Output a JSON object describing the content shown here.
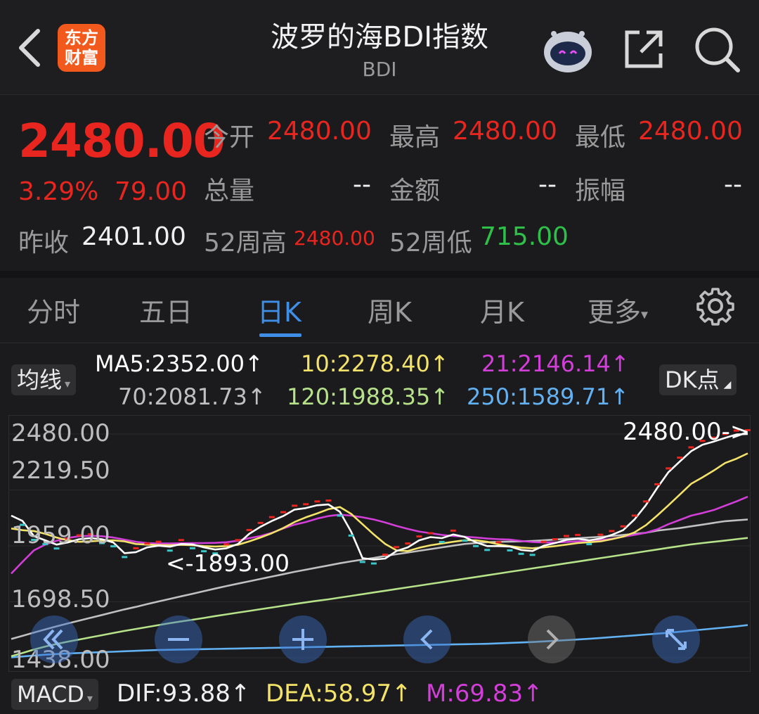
{
  "header": {
    "title": "波罗的海BDI指数",
    "subtitle": "BDI",
    "logo_text": [
      "东方",
      "财富"
    ],
    "icons": [
      "back-arrow-icon",
      "robot-assistant-icon",
      "share-icon",
      "search-icon"
    ]
  },
  "quote": {
    "price": "2480.00",
    "change_pct": "3.29%",
    "change": "79.00",
    "prev_close_label": "昨收",
    "prev_close": "2401.00",
    "fields": {
      "open_label": "今开",
      "open": "2480.00",
      "high_label": "最高",
      "high": "2480.00",
      "low_label": "最低",
      "low": "2480.00",
      "volume_label": "总量",
      "volume": "--",
      "amount_label": "金额",
      "amount": "--",
      "amplitude_label": "振幅",
      "amplitude": "--",
      "w52_high_label": "52周高",
      "w52_high": "2480.00",
      "w52_low_label": "52周低",
      "w52_low": "715.00"
    }
  },
  "tabs": [
    {
      "label": "分时",
      "active": false
    },
    {
      "label": "五日",
      "active": false
    },
    {
      "label": "日K",
      "active": true
    },
    {
      "label": "周K",
      "active": false
    },
    {
      "label": "月K",
      "active": false
    },
    {
      "label": "更多",
      "active": false
    }
  ],
  "indicators": {
    "ma_selector": "均线",
    "dk_button": "DK点",
    "ma5": "MA5:2352.00↑",
    "ma10": "10:2278.40↑",
    "ma21": "21:2146.14↑",
    "ma70": "70:2081.73↑",
    "ma120": "120:1988.35↑",
    "ma250": "250:1589.71↑"
  },
  "colors": {
    "up": "#e8261f",
    "down": "#2fc04a",
    "accent": "#3f8fe8",
    "ma5": "#ffffff",
    "ma10": "#f3e36a",
    "ma21": "#d23ed8",
    "ma70": "#c0c0c0",
    "ma120": "#b6e28a",
    "ma250": "#62b1f2"
  },
  "chart_data": {
    "type": "line",
    "y_ticks": [
      "2480.00",
      "2219.50",
      "1959.00",
      "1698.50",
      "1438.00"
    ],
    "ylim": [
      1438,
      2480
    ],
    "max_label": "2480.00->",
    "min_label": "<-1893.00",
    "x": [
      0,
      1,
      2,
      3,
      4,
      5,
      6,
      7,
      8,
      9,
      10,
      11,
      12,
      13,
      14,
      15,
      16,
      17,
      18,
      19,
      20,
      21,
      22,
      23,
      24,
      25,
      26,
      27,
      28,
      29,
      30,
      31,
      32,
      33,
      34,
      35,
      36,
      37,
      38,
      39,
      40,
      41,
      42,
      43,
      44,
      45,
      46,
      47,
      48,
      49,
      50,
      51,
      52,
      53,
      54,
      55,
      56,
      57,
      58,
      59,
      60,
      61,
      62,
      63,
      64,
      65
    ],
    "series": [
      {
        "name": "MA5",
        "values": [
          2100,
          2075,
          2005,
          1985,
          1965,
          1975,
          1990,
          1995,
          1990,
          1975,
          1925,
          1930,
          1952,
          1960,
          1955,
          1968,
          1966,
          1952,
          1942,
          1948,
          1968,
          2015,
          2048,
          2075,
          2098,
          2128,
          2135,
          2148,
          2152,
          2118,
          2025,
          1902,
          1895,
          1900,
          1935,
          1952,
          1985,
          2000,
          1995,
          2012,
          2001,
          1976,
          1958,
          1958,
          1956,
          1940,
          1935,
          1960,
          1972,
          1987,
          1992,
          1985,
          1993,
          2010,
          2032,
          2082,
          2148,
          2228,
          2302,
          2352,
          2400,
          2430,
          2445,
          2462,
          2478,
          2480
        ]
      },
      {
        "name": "10",
        "values": [
          2040,
          2032,
          2028,
          2015,
          1998,
          1985,
          1978,
          1980,
          1984,
          1985,
          1980,
          1968,
          1965,
          1963,
          1962,
          1964,
          1962,
          1958,
          1956,
          1958,
          1964,
          1980,
          1998,
          2018,
          2042,
          2070,
          2092,
          2110,
          2130,
          2140,
          2108,
          2060,
          2012,
          1968,
          1938,
          1935,
          1950,
          1962,
          1970,
          1978,
          1985,
          1985,
          1978,
          1966,
          1958,
          1951,
          1948,
          1952,
          1958,
          1965,
          1972,
          1976,
          1980,
          1990,
          2002,
          2022,
          2055,
          2100,
          2148,
          2198,
          2248,
          2278,
          2310,
          2345,
          2365,
          2390
        ]
      },
      {
        "name": "21",
        "values": [
          1830,
          1885,
          1938,
          1965,
          1983,
          1996,
          2004,
          2006,
          2004,
          1998,
          1988,
          1978,
          1972,
          1970,
          1970,
          1971,
          1972,
          1972,
          1973,
          1976,
          1983,
          1995,
          2005,
          2020,
          2040,
          2058,
          2070,
          2086,
          2098,
          2104,
          2100,
          2092,
          2082,
          2068,
          2052,
          2038,
          2026,
          2018,
          2010,
          2005,
          2002,
          1998,
          1993,
          1990,
          1988,
          1982,
          1977,
          1975,
          1975,
          1977,
          1980,
          1982,
          1986,
          1992,
          2002,
          2010,
          2020,
          2036,
          2060,
          2080,
          2100,
          2112,
          2126,
          2146,
          2166,
          2188
        ]
      },
      {
        "name": "70",
        "values": [
          1525,
          1540,
          1555,
          1570,
          1584,
          1598,
          1611,
          1624,
          1637,
          1650,
          1663,
          1675,
          1688,
          1700,
          1712,
          1724,
          1736,
          1748,
          1760,
          1772,
          1783,
          1794,
          1805,
          1816,
          1827,
          1838,
          1848,
          1858,
          1868,
          1878,
          1887,
          1895,
          1903,
          1912,
          1920,
          1928,
          1936,
          1944,
          1952,
          1960,
          1968,
          1972,
          1976,
          1978,
          1979,
          1980,
          1982,
          1985,
          1988,
          1992,
          1995,
          1998,
          2001,
          2005,
          2010,
          2015,
          2020,
          2030,
          2036,
          2042,
          2050,
          2058,
          2066,
          2074,
          2078,
          2082
        ]
      },
      {
        "name": "120",
        "values": [
          1445,
          1460,
          1476,
          1490,
          1502,
          1513,
          1523,
          1533,
          1543,
          1553,
          1563,
          1572,
          1581,
          1590,
          1599,
          1607,
          1615,
          1623,
          1632,
          1640,
          1648,
          1656,
          1664,
          1672,
          1680,
          1688,
          1696,
          1703,
          1710,
          1718,
          1726,
          1734,
          1742,
          1750,
          1758,
          1766,
          1774,
          1782,
          1790,
          1798,
          1806,
          1814,
          1822,
          1830,
          1838,
          1846,
          1854,
          1862,
          1870,
          1878,
          1886,
          1894,
          1902,
          1910,
          1918,
          1926,
          1934,
          1942,
          1950,
          1958,
          1966,
          1972,
          1978,
          1984,
          1990,
          1996
        ]
      },
      {
        "name": "250",
        "values": [
          1440,
          1444,
          1448,
          1452,
          1455,
          1458,
          1460,
          1462,
          1464,
          1466,
          1468,
          1470,
          1472,
          1474,
          1475,
          1476,
          1477,
          1478,
          1479,
          1480,
          1481,
          1482,
          1483,
          1484,
          1485,
          1486,
          1487,
          1488,
          1489,
          1490,
          1491,
          1492,
          1493,
          1494,
          1495,
          1496,
          1497,
          1498,
          1499,
          1500,
          1501,
          1502,
          1503,
          1505,
          1507,
          1509,
          1511,
          1514,
          1517,
          1520,
          1523,
          1526,
          1530,
          1534,
          1538,
          1542,
          1546,
          1550,
          1554,
          1559,
          1564,
          1569,
          1574,
          1579,
          1584,
          1590
        ]
      }
    ]
  },
  "macd": {
    "selector": "MACD",
    "dif": "DIF:93.88↑",
    "dea": "DEA:58.97↑",
    "m": "M:69.83↑"
  },
  "controls": [
    "rewind-icon",
    "zoom-out-icon",
    "zoom-in-icon",
    "prev-icon",
    "next-icon",
    "fullscreen-icon"
  ]
}
